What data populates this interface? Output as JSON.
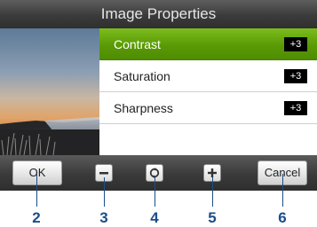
{
  "window": {
    "title": "Image Properties"
  },
  "properties": [
    {
      "label": "Contrast",
      "value": "+3",
      "selected": true
    },
    {
      "label": "Saturation",
      "value": "+3",
      "selected": false
    },
    {
      "label": "Sharpness",
      "value": "+3",
      "selected": false
    }
  ],
  "toolbar": {
    "ok_label": "OK",
    "decrease_icon": "minus-icon",
    "reset_icon": "reset-circle-icon",
    "increase_icon": "plus-icon",
    "cancel_label": "Cancel"
  },
  "callouts": [
    "2",
    "3",
    "4",
    "5",
    "6"
  ],
  "colors": {
    "selected_row": "#5a9a05",
    "title_bar": "#3b3b3b",
    "callout": "#1a4e8a",
    "badge": "#000000"
  }
}
